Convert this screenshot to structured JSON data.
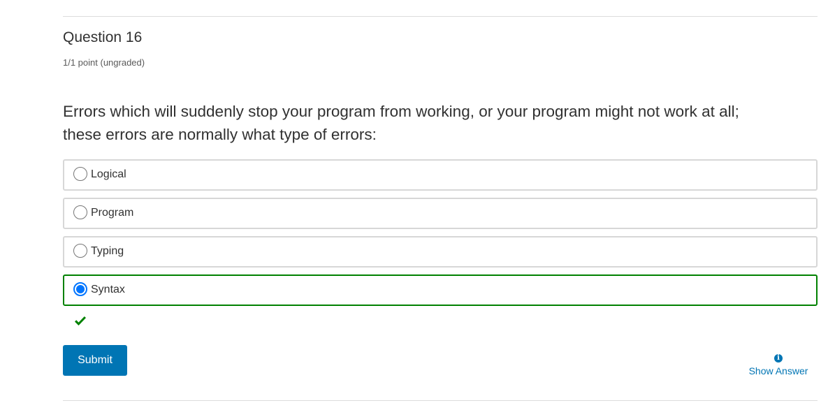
{
  "problem": {
    "title": "Question 16",
    "points": "1/1 point (ungraded)",
    "prompt_line1": "Errors which will suddenly stop your program from working, or your program might not work at all;",
    "prompt_line2": "these errors are normally what type of errors:"
  },
  "choices": [
    {
      "label": "Logical",
      "selected": false
    },
    {
      "label": "Program",
      "selected": false
    },
    {
      "label": "Typing",
      "selected": false
    },
    {
      "label": "Syntax",
      "selected": true,
      "status": "correct"
    }
  ],
  "status_icon": "checkmark-icon",
  "actions": {
    "submit_label": "Submit",
    "show_answer_label": "Show Answer",
    "show_answer_icon": "info-icon"
  },
  "colors": {
    "accent": "#0075b4",
    "correct": "#008100",
    "radio_selected": "#0075ff"
  }
}
